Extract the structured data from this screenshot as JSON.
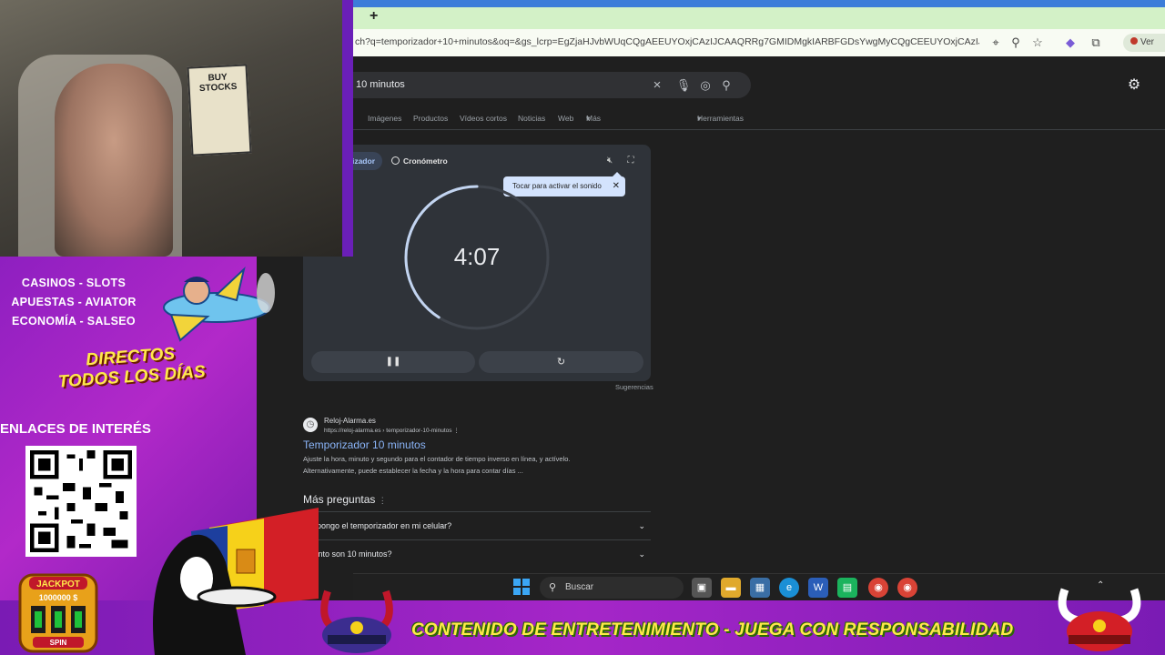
{
  "browser": {
    "url": "ch?q=temporizador+10+minutos&oq=&gs_lcrp=EgZjaHJvbWUqCQgAEEUYOxjCAzIJCAAQRRg7GMIDMgkIARBFGDsYwgMyCQgCEEUYOxjCAzIJCAMQ...",
    "profile_label": "Ver"
  },
  "search": {
    "query": "10 minutos",
    "tabs": [
      "Imágenes",
      "Productos",
      "Vídeos cortos",
      "Noticias",
      "Web",
      "Más"
    ],
    "tools": "Herramientas"
  },
  "timer": {
    "tab_active": "izador",
    "tab_other": "Cronómetro",
    "tooltip": "Tocar para activar el sonido",
    "time": "4:07",
    "progress": 0.41,
    "suggestions": "Sugerencias"
  },
  "result": {
    "site_name": "Reloj-Alarma.es",
    "site_url": "https://reloj-alarma.es › temporizador-10-minutos",
    "title": "Temporizador 10 minutos",
    "desc_line1": "Ajuste la hora, minuto y segundo para el contador de tiempo inverso en línea, y actívelo.",
    "desc_line2": "Alternativamente, puede establecer la fecha y la hora para contar días ..."
  },
  "faq": {
    "heading": "Más preguntas",
    "items": [
      "mo pongo el temporizador en mi celular?",
      "Cuánto son 10 minutos?"
    ]
  },
  "taskbar": {
    "search_placeholder": "Buscar"
  },
  "overlay": {
    "poster_text": "BUY STOCKS",
    "promo_lines": [
      "CASINOS - SLOTS",
      "APUESTAS - AVIATOR",
      "ECONOMÍA - SALSEO"
    ],
    "directos_line1": "DIRECTOS",
    "directos_line2": "TODOS LOS DÍAS",
    "links_heading": "ENLACES DE INTERÉS",
    "tagline": "CONTENIDO DE ENTRETENIMIENTO - JUEGA CON RESPONSABILIDAD",
    "jackpot_label": "JACKPOT",
    "jackpot_amount": "1000000 $",
    "spin_label": "SPIN"
  },
  "colors": {
    "accent_purple": "#a526c8",
    "link_blue": "#8ab4f8",
    "tagline_yellow": "#ffe94a"
  }
}
